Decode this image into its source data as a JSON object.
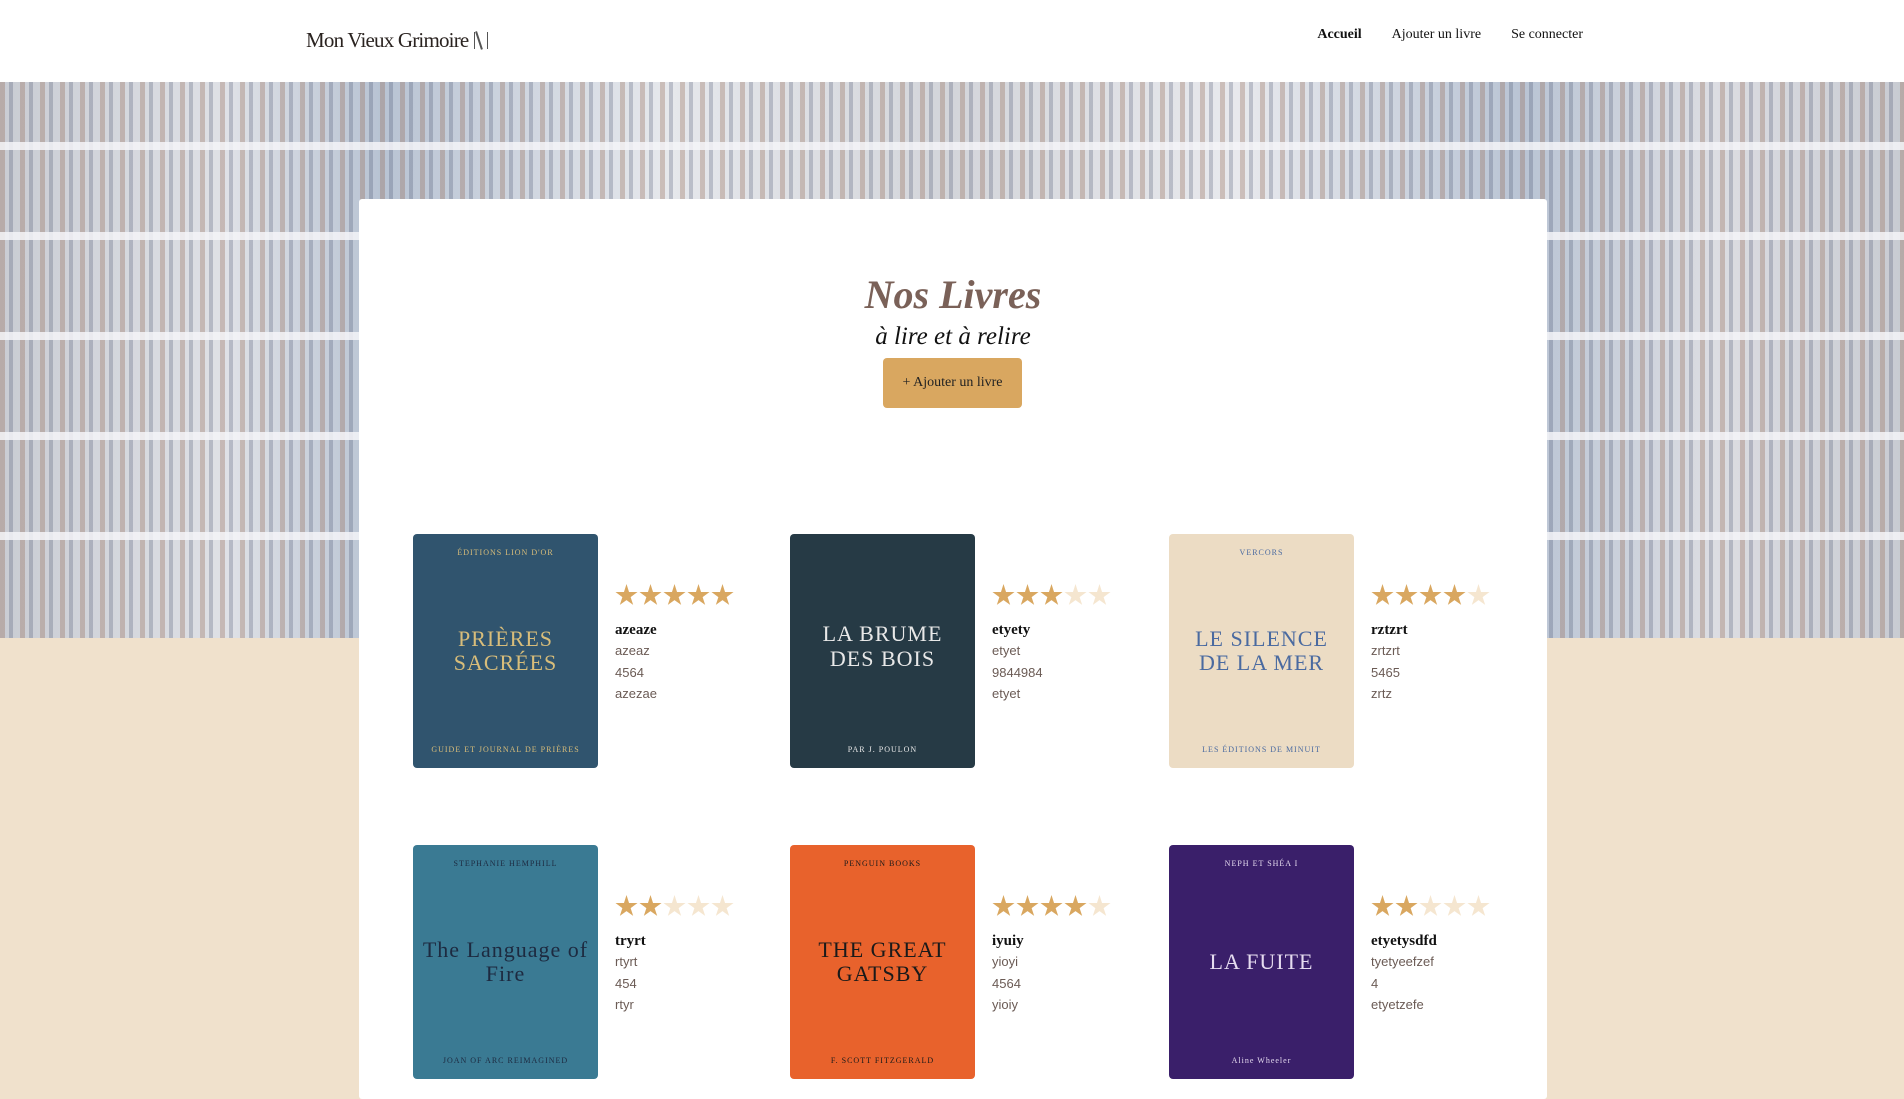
{
  "nav": {
    "logo": "Mon Vieux Grimoire",
    "links": [
      {
        "label": "Accueil",
        "active": true
      },
      {
        "label": "Ajouter un livre"
      },
      {
        "label": "Se connecter"
      }
    ]
  },
  "main": {
    "title": "Nos Livres",
    "subtitle": "à lire et à relire",
    "add_button": "+ Ajouter un livre"
  },
  "colors": {
    "accent": "#d9a760",
    "background": "#f0e1cc",
    "title": "#7a6158"
  },
  "books": [
    {
      "title": "azeaze",
      "author": "azeaz",
      "year": "4564",
      "genre": "azezae",
      "rating": 5,
      "cover": {
        "bg": "#30546e",
        "fg": "#d8bd7a",
        "top": "ÉDITIONS LION D'OR",
        "main": "PRIÈRES SACRÉES",
        "bottom": "GUIDE ET JOURNAL DE PRIÈRES"
      }
    },
    {
      "title": "etyety",
      "author": "etyet",
      "year": "9844984",
      "genre": "etyet",
      "rating": 3,
      "cover": {
        "bg": "#263a45",
        "fg": "#e8e8e8",
        "top": "",
        "main": "LA BRUME DES BOIS",
        "bottom": "PAR J. POULON"
      }
    },
    {
      "title": "rztzrt",
      "author": "zrtzrt",
      "year": "5465",
      "genre": "zrtz",
      "rating": 4,
      "cover": {
        "bg": "#ecdcc4",
        "fg": "#4a6aa0",
        "top": "VERCORS",
        "main": "LE SILENCE DE LA MER",
        "bottom": "LES ÉDITIONS DE MINUIT"
      }
    },
    {
      "title": "tryrt",
      "author": "rtyrt",
      "year": "454",
      "genre": "rtyr",
      "rating": 2,
      "cover": {
        "bg": "#3a7a93",
        "fg": "#1d2a40",
        "top": "STEPHANIE HEMPHILL",
        "main": "The Language of Fire",
        "bottom": "JOAN OF ARC REIMAGINED"
      }
    },
    {
      "title": "iyuiy",
      "author": "yioyi",
      "year": "4564",
      "genre": "yioiy",
      "rating": 4,
      "cover": {
        "bg": "#e8622c",
        "fg": "#1a1a1a",
        "top": "PENGUIN BOOKS",
        "main": "THE GREAT GATSBY",
        "bottom": "F. SCOTT FITZGERALD"
      }
    },
    {
      "title": "etyetysdfd",
      "author": "tyetyeefzef",
      "year": "4",
      "genre": "etyetzefe",
      "rating": 2,
      "cover": {
        "bg": "#3a1f6a",
        "fg": "#e6dcf0",
        "top": "NEPH ET SHÉA I",
        "main": "LA FUITE",
        "bottom": "Aline Wheeler"
      }
    }
  ]
}
